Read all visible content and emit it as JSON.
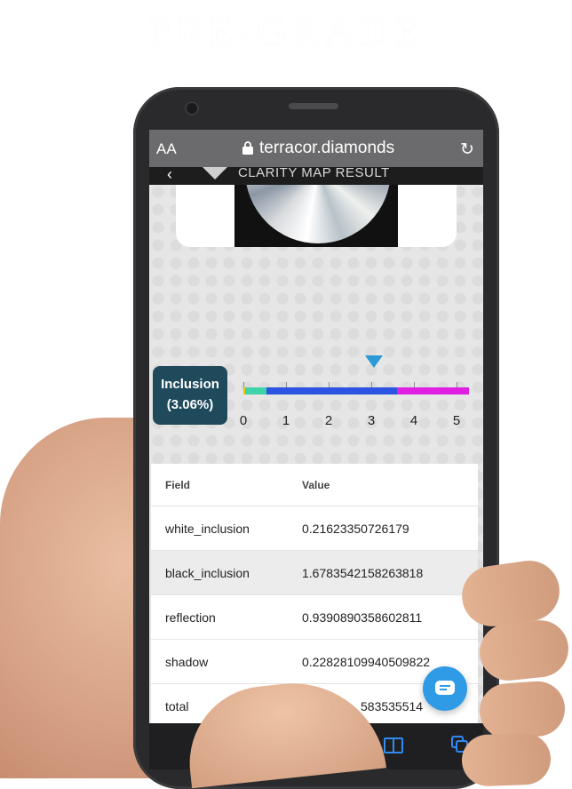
{
  "brand": {
    "text": "PRE-GRADE"
  },
  "browser": {
    "text_size_label": "AA",
    "url": "terracor.diamonds"
  },
  "app_header": {
    "title": "CLARITY MAP RESULT"
  },
  "inclusion": {
    "label": "Inclusion",
    "value": "(3.06%)",
    "level": 3.06,
    "scale": {
      "ticks": [
        "0",
        "1",
        "2",
        "3",
        "4",
        "5"
      ],
      "segments": [
        {
          "from": 0,
          "to": 0.05,
          "color": "#f2c500"
        },
        {
          "from": 0.05,
          "to": 0.55,
          "color": "#3fd3a8"
        },
        {
          "from": 0.55,
          "to": 3.6,
          "color": "#2b54e0"
        },
        {
          "from": 3.6,
          "to": 5.3,
          "color": "#e020e0"
        }
      ],
      "marker_color": "#2b9bd8"
    }
  },
  "table": {
    "headers": {
      "field": "Field",
      "value": "Value"
    },
    "rows": [
      {
        "field": "white_inclusion",
        "value": "0.21623350726179"
      },
      {
        "field": "black_inclusion",
        "value": "1.6783542158263818"
      },
      {
        "field": "reflection",
        "value": "0.9390890358602811"
      },
      {
        "field": "shadow",
        "value": "0.22828109940509822"
      },
      {
        "field": "total",
        "value": "583535514"
      }
    ]
  },
  "icons": {
    "chat": "chat-bubble-icon",
    "bookmarks": "book-icon",
    "tabs": "tabs-icon"
  },
  "colors": {
    "accent": "#2f9be6",
    "badge": "#1f4a5c"
  }
}
